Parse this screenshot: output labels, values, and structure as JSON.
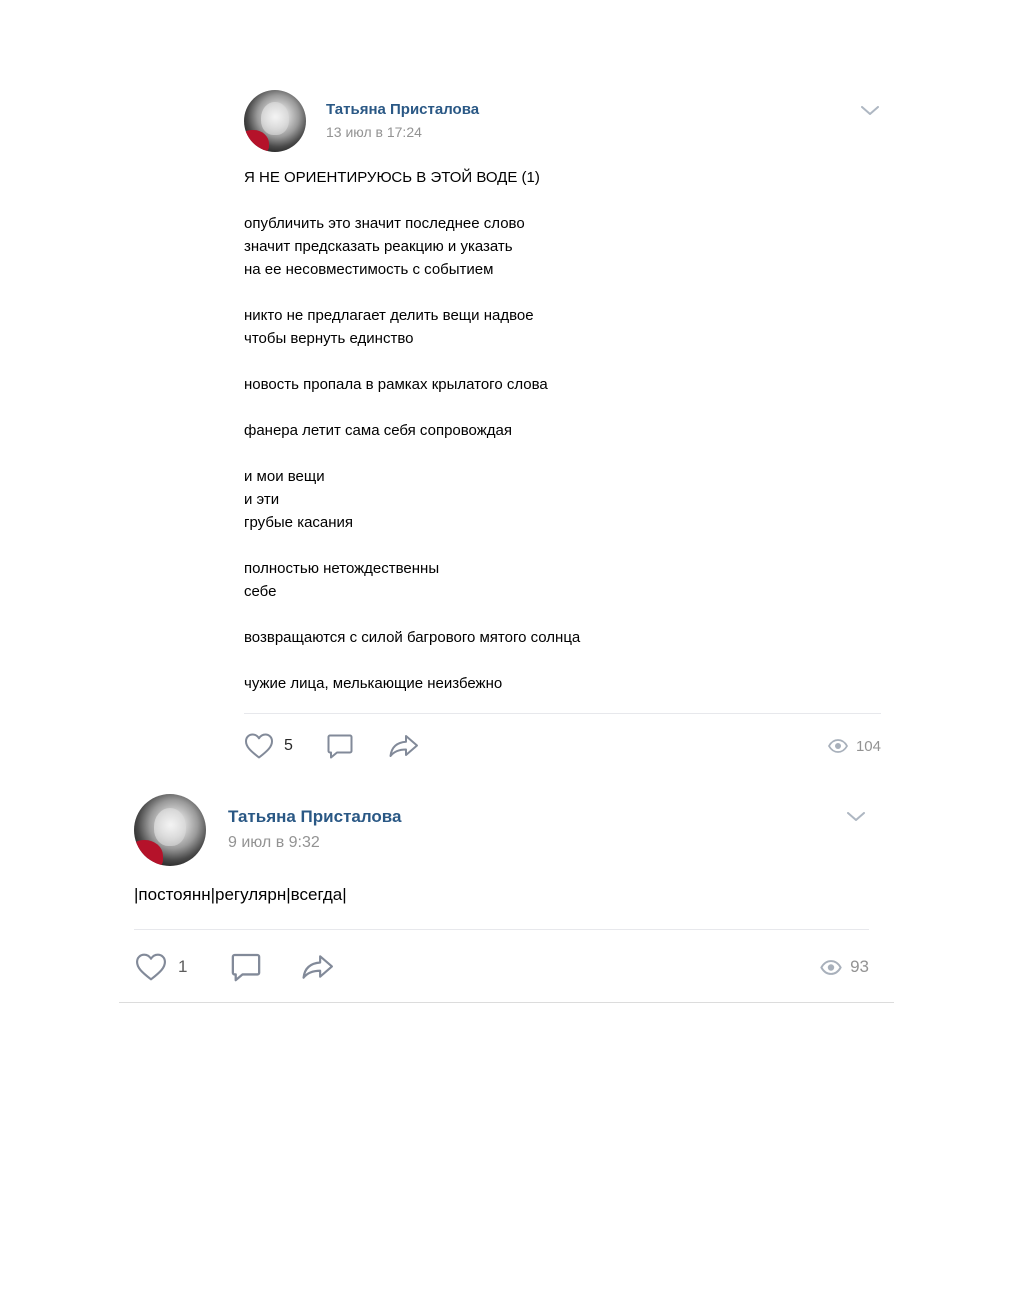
{
  "colors": {
    "author_link": "#2a5885",
    "meta_gray": "#939393",
    "icon_gray": "#828a99",
    "divider": "#e7e8ec"
  },
  "posts": [
    {
      "author": "Татьяна Присталова",
      "date": "13 июл в 17:24",
      "text": "Я НЕ ОРИЕНТИРУЮСЬ В ЭТОЙ ВОДЕ (1)\n\nопубличить это значит последнее слово\nзначит предсказать реакцию и указать\nна ее несовместимость с событием\n\nникто не предлагает делить вещи надвое\nчтобы вернуть единство\n\nновость пропала в рамках крылатого слова\n\nфанера летит сама себя сопровождая\n\nи мои вещи\nи эти\nгрубые касания\n\nполностью нетождественны\nсебе\n\nвозвращаются с силой багрового мятого солнца\n\nчужие лица, мелькающие неизбежно",
      "likes": "5",
      "views": "104",
      "icons": {
        "menu": "chevron-down-icon",
        "like": "heart-icon",
        "comment": "comment-icon",
        "share": "share-icon",
        "views": "eye-icon"
      }
    },
    {
      "author": "Татьяна Присталова",
      "date": "9 июл в 9:32",
      "text": "|постоянн|регулярн|всегда|",
      "likes": "1",
      "views": "93",
      "icons": {
        "menu": "chevron-down-icon",
        "like": "heart-icon",
        "comment": "comment-icon",
        "share": "share-icon",
        "views": "eye-icon"
      }
    }
  ]
}
